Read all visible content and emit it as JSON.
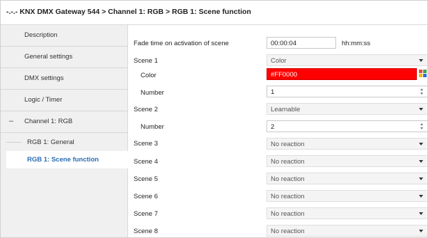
{
  "title": "-.-.- KNX DMX Gateway 544 > Channel 1: RGB > RGB 1: Scene function",
  "sidebar": {
    "items": [
      {
        "label": "Description"
      },
      {
        "label": "General settings"
      },
      {
        "label": "DMX settings"
      },
      {
        "label": "Logic / Timer"
      }
    ],
    "group": {
      "label": "Channel 1: RGB",
      "collapse_symbol": "–"
    },
    "sub_items": [
      {
        "label": "RGB 1: General"
      },
      {
        "label": "RGB 1: Scene function"
      }
    ]
  },
  "form": {
    "fade": {
      "label": "Fade time on activation of scene",
      "value": "00:00:04",
      "unit": "hh:mm:ss"
    },
    "scene1": {
      "label": "Scene 1",
      "value": "Color"
    },
    "scene1_color": {
      "label": "Color",
      "value": "#FF0000"
    },
    "scene1_number": {
      "label": "Number",
      "value": "1"
    },
    "scene2": {
      "label": "Scene 2",
      "value": "Learnable"
    },
    "scene2_number": {
      "label": "Number",
      "value": "2"
    },
    "scenes": [
      {
        "label": "Scene 3",
        "value": "No reaction"
      },
      {
        "label": "Scene 4",
        "value": "No reaction"
      },
      {
        "label": "Scene 5",
        "value": "No reaction"
      },
      {
        "label": "Scene 6",
        "value": "No reaction"
      },
      {
        "label": "Scene 7",
        "value": "No reaction"
      },
      {
        "label": "Scene 8",
        "value": "No reaction"
      }
    ]
  },
  "colors": {
    "selected_color": "#FF0000",
    "active_nav": "#2B6CB3",
    "sidebar_bg": "#F0F0F0"
  },
  "icons": {
    "palette": "color-palette-icon",
    "collapse": "collapse-minus-icon",
    "dropdown": "chevron-down-icon",
    "spinner": "spin-arrows-icon"
  }
}
